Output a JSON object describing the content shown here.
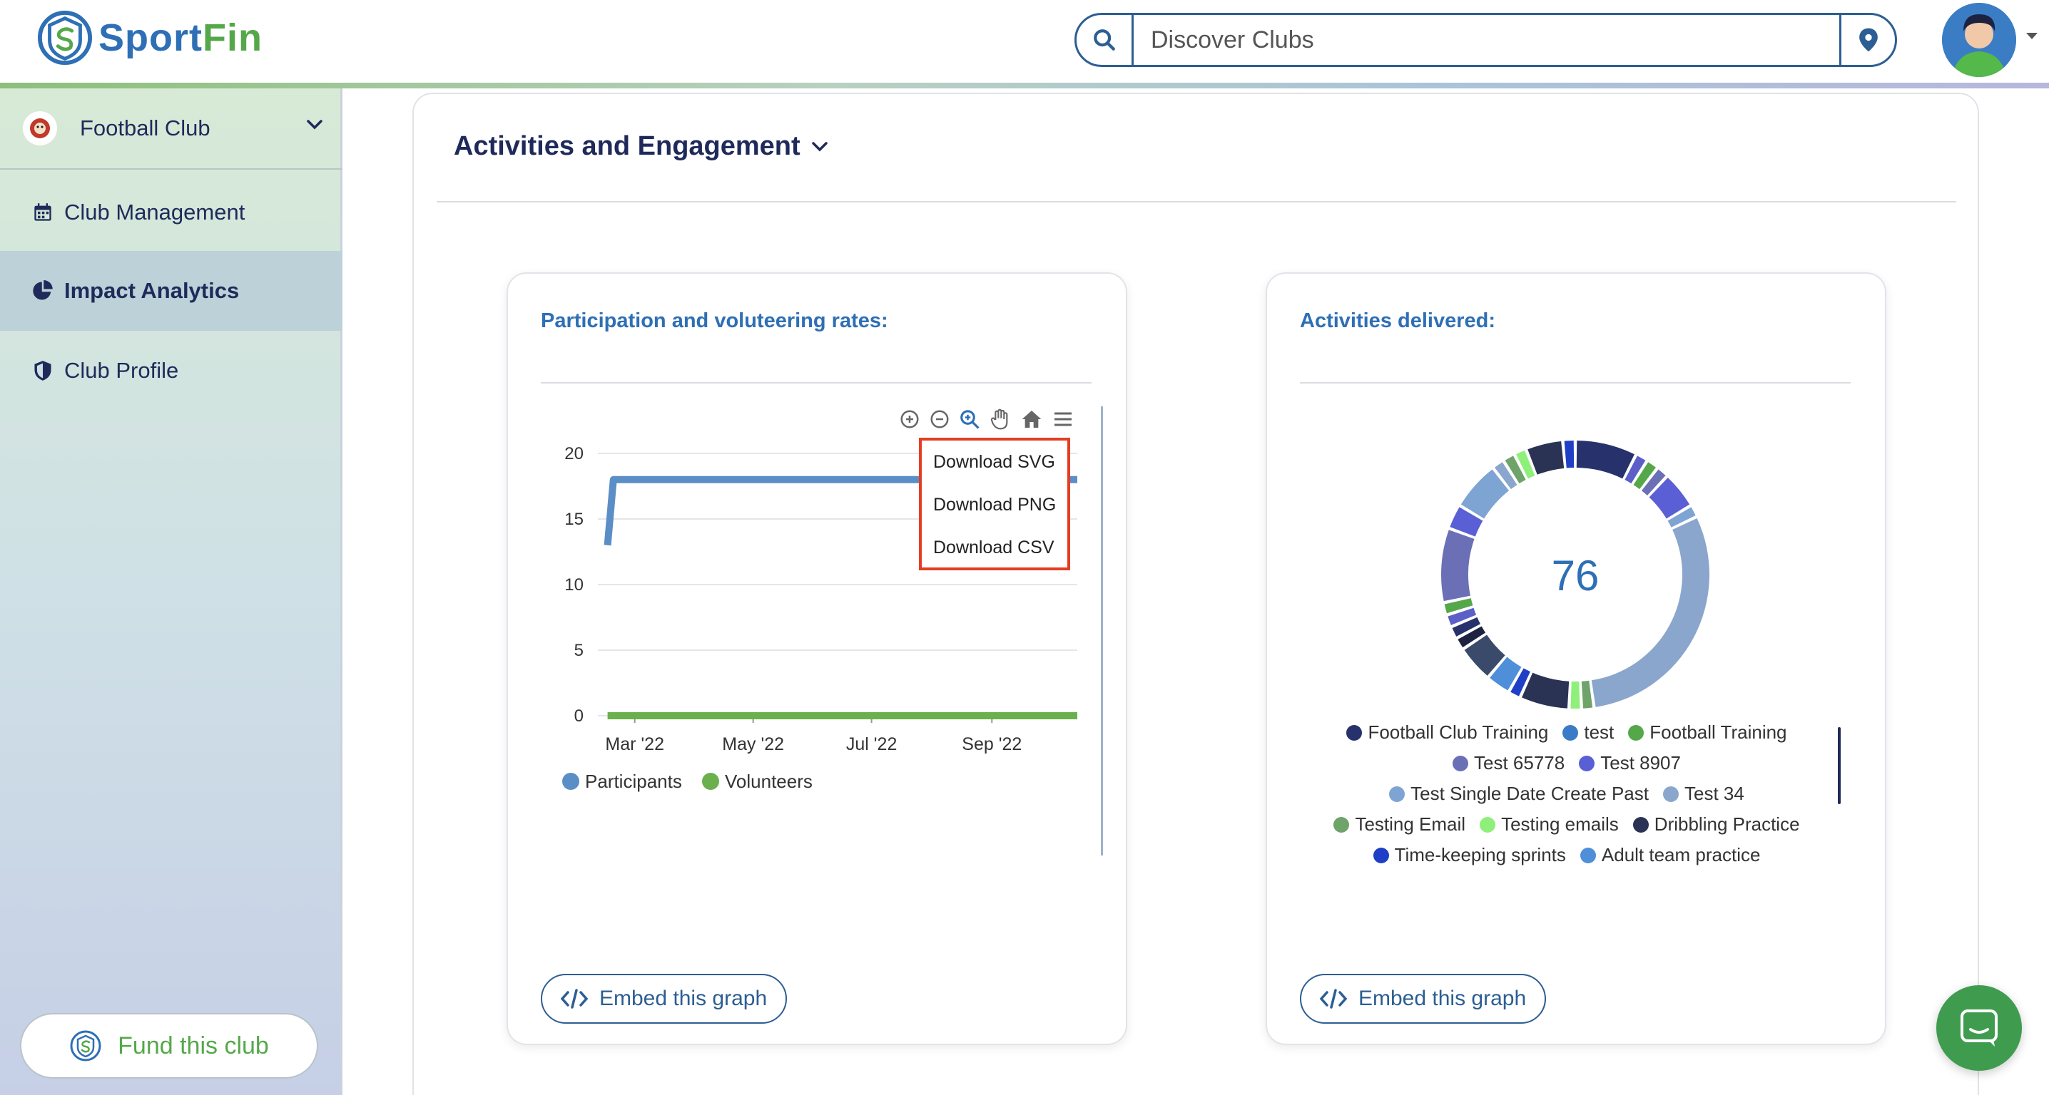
{
  "header": {
    "logo_sport": "Sport",
    "logo_fin": "Fin",
    "search_placeholder": "Discover Clubs"
  },
  "sidebar": {
    "club_name": "Football Club",
    "items": [
      {
        "label": "Club Management",
        "icon": "calendar-icon"
      },
      {
        "label": "Impact Analytics",
        "icon": "pie-chart-icon",
        "active": true
      },
      {
        "label": "Club Profile",
        "icon": "shield-icon"
      }
    ],
    "fund_label": "Fund this club"
  },
  "main": {
    "section_title": "Activities and Engagement",
    "participation_card": {
      "title": "Participation and voluteering rates:",
      "embed_label": "Embed this graph",
      "menu": [
        "Download SVG",
        "Download PNG",
        "Download CSV"
      ]
    },
    "activities_card": {
      "title": "Activities delivered:",
      "total": "76",
      "embed_label": "Embed this graph"
    }
  },
  "chart_data": [
    {
      "type": "line",
      "title": "Participation and voluteering rates:",
      "ylim": [
        0,
        20
      ],
      "y_ticks": [
        "0",
        "5",
        "10",
        "15",
        "20"
      ],
      "x_ticks": [
        "Mar '22",
        "May '22",
        "Jul '22",
        "Sep '22"
      ],
      "x": [
        "2022-02-15",
        "2022-02-18",
        "2022-03-01",
        "2022-05-01",
        "2022-07-01",
        "2022-09-01",
        "2022-10-15"
      ],
      "series": [
        {
          "name": "Participants",
          "color": "#5b8ec6",
          "values": [
            13,
            18,
            18,
            18,
            18,
            18,
            18
          ]
        },
        {
          "name": "Volunteers",
          "color": "#6ab04c",
          "values": [
            0,
            0,
            0,
            0,
            0,
            0,
            0
          ]
        }
      ]
    },
    {
      "type": "pie",
      "title": "Activities delivered:",
      "center_label": "76",
      "legend": [
        {
          "name": "Football Club Training",
          "color": "#27316b"
        },
        {
          "name": "test",
          "color": "#3a7bc8"
        },
        {
          "name": "Football Training",
          "color": "#55a84a"
        },
        {
          "name": "Test 65778",
          "color": "#6b6fb5"
        },
        {
          "name": "Test 8907",
          "color": "#5a5fd6"
        },
        {
          "name": "Test Single Date Create Past",
          "color": "#7ea4d4"
        },
        {
          "name": "Test 34",
          "color": "#8aa6cc"
        },
        {
          "name": "Testing Email",
          "color": "#6ea36a"
        },
        {
          "name": "Testing emails",
          "color": "#8ef07a"
        },
        {
          "name": "Dribbling Practice",
          "color": "#2a3354"
        },
        {
          "name": "Time-keeping sprints",
          "color": "#1f3fc7"
        },
        {
          "name": "Adult team practice",
          "color": "#4f8fd9"
        }
      ],
      "values": [
        5,
        1,
        1,
        1,
        3,
        1,
        20,
        1,
        1,
        4,
        1,
        2,
        3,
        1,
        1,
        1,
        1,
        6,
        2,
        4,
        1,
        1,
        1,
        3,
        1
      ]
    }
  ]
}
